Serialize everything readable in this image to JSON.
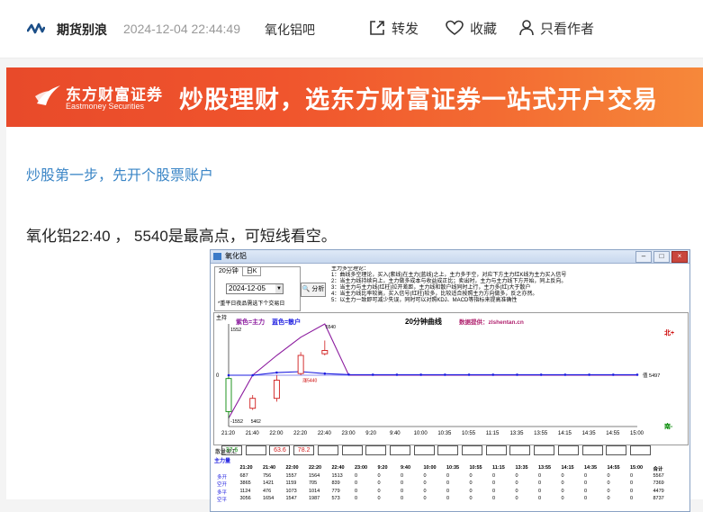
{
  "header": {
    "forum_name": "期货别浪",
    "post_time": "2024-12-04 22:44:49",
    "board_name": "氧化铝吧",
    "actions": [
      {
        "label": "转发",
        "icon": "share-icon"
      },
      {
        "label": "收藏",
        "icon": "heart-icon"
      },
      {
        "label": "只看作者",
        "icon": "user-icon"
      }
    ]
  },
  "banner": {
    "brand_cn": "东方财富证券",
    "brand_en": "Eastmoney Securities",
    "slogan": "炒股理财，选东方财富证券一站式开户交易"
  },
  "promo_link": "炒股第一步，先开个股票账户",
  "post_text": "氧化铝22:40 ， 5540是最高点，可短线看空。",
  "window": {
    "title": "氧化铝",
    "tabs": [
      "20分钟",
      "日K"
    ],
    "date": "2024-12-05",
    "hint": "*重平日夜品需选下个交易日",
    "analyze_label": "分析",
    "notes": [
      "主力多空理论：",
      "1：曲线多空理论，买入(紫线)在主力(蓝线)之上，主力多于空，对应下方主力红K线为主力买入信号",
      "2：当主力线持续向上，主力做多成本与收益成正比；卖出时，主力与主力线下方开始，同上反向。",
      "3：当主力与主力线(红柱)拉开差距，主力线和散户线同时上行，主力多(红)大于散户",
      "4：当主力线比率较高，买入信号(红柱)较多，比较适合按照主力方向做多，反之亦然。",
      "5：以主力一致即可减少失误，同时可以对照KDJ、MACD等指标来提高准确性"
    ],
    "chart_data": {
      "type": "line",
      "title": "20分钟曲线",
      "source_label": "数据提供：zlshentan.cn",
      "legend": [
        {
          "name": "紫色=主力",
          "color": "#8b1a9e"
        },
        {
          "name": "蓝色=散户",
          "color": "#1c1ce0"
        }
      ],
      "y_label_top": "1552",
      "y_label_bottom": "-1552",
      "zero_label": "0",
      "right_top_label": "北+",
      "right_bottom_label": "南-",
      "right_value_label": "值 5497",
      "point_labels": [
        "5540",
        "5462",
        "涨5440"
      ],
      "corner_label": "主持",
      "ylim": [
        -1552,
        1552
      ],
      "x": [
        "21:20",
        "21:40",
        "22:00",
        "22:20",
        "22:40",
        "23:00",
        "9:20",
        "9:40",
        "10:00",
        "10:35",
        "10:55",
        "11:15",
        "13:35",
        "13:55",
        "14:15",
        "14:35",
        "14:55",
        "15:00"
      ],
      "series": [
        {
          "name": "紫色=主力",
          "color": "#8b1a9e",
          "values": [
            -1300,
            0,
            600,
            1150,
            1552,
            0,
            0,
            0,
            0,
            0,
            0,
            0,
            0,
            0,
            0,
            0,
            0,
            0
          ]
        },
        {
          "name": "蓝色=散户",
          "color": "#1c1ce0",
          "values": [
            0,
            0,
            80,
            110,
            50,
            20,
            15,
            15,
            15,
            15,
            15,
            15,
            15,
            15,
            15,
            15,
            15,
            15
          ]
        }
      ],
      "candles": [
        {
          "x": "21:20",
          "open": -100,
          "close": -1100,
          "high": -50,
          "low": -1300,
          "color": "green"
        },
        {
          "x": "21:40",
          "open": -700,
          "close": -1000,
          "high": -600,
          "low": -1050,
          "color": "red"
        },
        {
          "x": "22:00",
          "open": -700,
          "close": -150,
          "high": 0,
          "low": -800,
          "color": "red"
        },
        {
          "x": "22:20",
          "open": 50,
          "close": 600,
          "high": 700,
          "low": 0,
          "color": "red"
        },
        {
          "x": "22:40",
          "open": 650,
          "close": 750,
          "high": 1050,
          "low": 600,
          "color": "red"
        }
      ]
    },
    "volume_row": {
      "label": "散量差汇",
      "values": [
        "37.6",
        "",
        "63.6",
        "78.2",
        "",
        "",
        "",
        "",
        "",
        "",
        "",
        "",
        "",
        "",
        "",
        "",
        "",
        ""
      ],
      "colors": [
        "green",
        "",
        "red",
        "red",
        "",
        "",
        "",
        "",
        "",
        "",
        "",
        "",
        "",
        "",
        "",
        "",
        "",
        ""
      ]
    },
    "table": {
      "title": "主力量",
      "headers": [
        "",
        "21:20",
        "21:40",
        "22:00",
        "22:20",
        "22:40",
        "23:00",
        "9:20",
        "9:40",
        "10:00",
        "10:35",
        "10:55",
        "11:15",
        "13:35",
        "13:55",
        "14:15",
        "14:35",
        "14:55",
        "15:00",
        "合计"
      ],
      "rows": [
        [
          "多开",
          "687",
          "756",
          "1557",
          "1564",
          "1513",
          "0",
          "0",
          "0",
          "0",
          "0",
          "0",
          "0",
          "0",
          "0",
          "0",
          "0",
          "0",
          "0",
          "5567"
        ],
        [
          "空开",
          "3865",
          "1421",
          "1159",
          "705",
          "839",
          "0",
          "0",
          "0",
          "0",
          "0",
          "0",
          "0",
          "0",
          "0",
          "0",
          "0",
          "0",
          "0",
          "7369"
        ],
        [
          "多平",
          "1124",
          "476",
          "1073",
          "1014",
          "779",
          "0",
          "0",
          "0",
          "0",
          "0",
          "0",
          "0",
          "0",
          "0",
          "0",
          "0",
          "0",
          "0",
          "4479"
        ],
        [
          "空平",
          "3056",
          "1654",
          "1547",
          "1987",
          "573",
          "0",
          "0",
          "0",
          "0",
          "0",
          "0",
          "0",
          "0",
          "0",
          "0",
          "0",
          "0",
          "0",
          "8737"
        ]
      ]
    }
  },
  "colors": {
    "link": "#3a85c6",
    "banner_start": "#e84a2a",
    "banner_end": "#f6883a",
    "main_line": "#8b1a9e",
    "retail_line": "#1c1ce0"
  }
}
